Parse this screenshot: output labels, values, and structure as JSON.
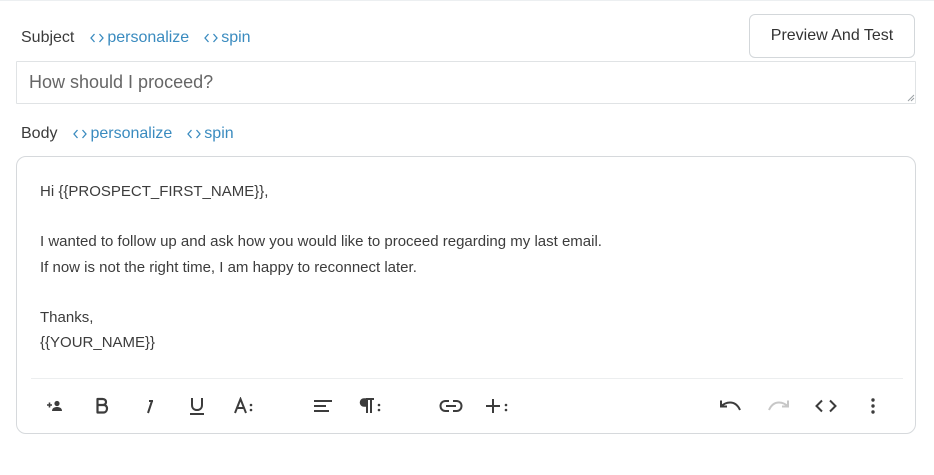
{
  "subject": {
    "label": "Subject",
    "personalize_label": "personalize",
    "spin_label": "spin",
    "value": "How should I proceed?"
  },
  "preview_button": {
    "label": "Preview And Test"
  },
  "body": {
    "label": "Body",
    "personalize_label": "personalize",
    "spin_label": "spin",
    "lines": [
      "Hi {{PROSPECT_FIRST_NAME}},",
      "",
      "I wanted to follow up and ask how you would like to proceed regarding my last email.",
      "If now is not the right time, I am happy to reconnect later.",
      "",
      "Thanks,",
      "{{YOUR_NAME}}"
    ]
  },
  "toolbar": {
    "buttons": [
      {
        "name": "insert-variable",
        "icon": "person-add-icon"
      },
      {
        "name": "bold",
        "icon": "bold-icon"
      },
      {
        "name": "italic",
        "icon": "italic-icon"
      },
      {
        "name": "underline",
        "icon": "underline-icon"
      },
      {
        "name": "font-size",
        "icon": "font-size-icon"
      },
      {
        "name": "align",
        "icon": "align-left-icon"
      },
      {
        "name": "paragraph",
        "icon": "paragraph-icon"
      },
      {
        "name": "link",
        "icon": "link-icon"
      },
      {
        "name": "insert",
        "icon": "plus-icon"
      },
      {
        "name": "undo",
        "icon": "undo-icon"
      },
      {
        "name": "redo",
        "icon": "redo-icon"
      },
      {
        "name": "code-view",
        "icon": "code-icon"
      },
      {
        "name": "more",
        "icon": "more-vertical-icon"
      }
    ]
  },
  "colors": {
    "accent": "#3a8bbf",
    "text": "#3c3c3c",
    "border": "#d6d9dc",
    "icon": "#3c3c3c",
    "icon_disabled": "#c7c7c7"
  }
}
